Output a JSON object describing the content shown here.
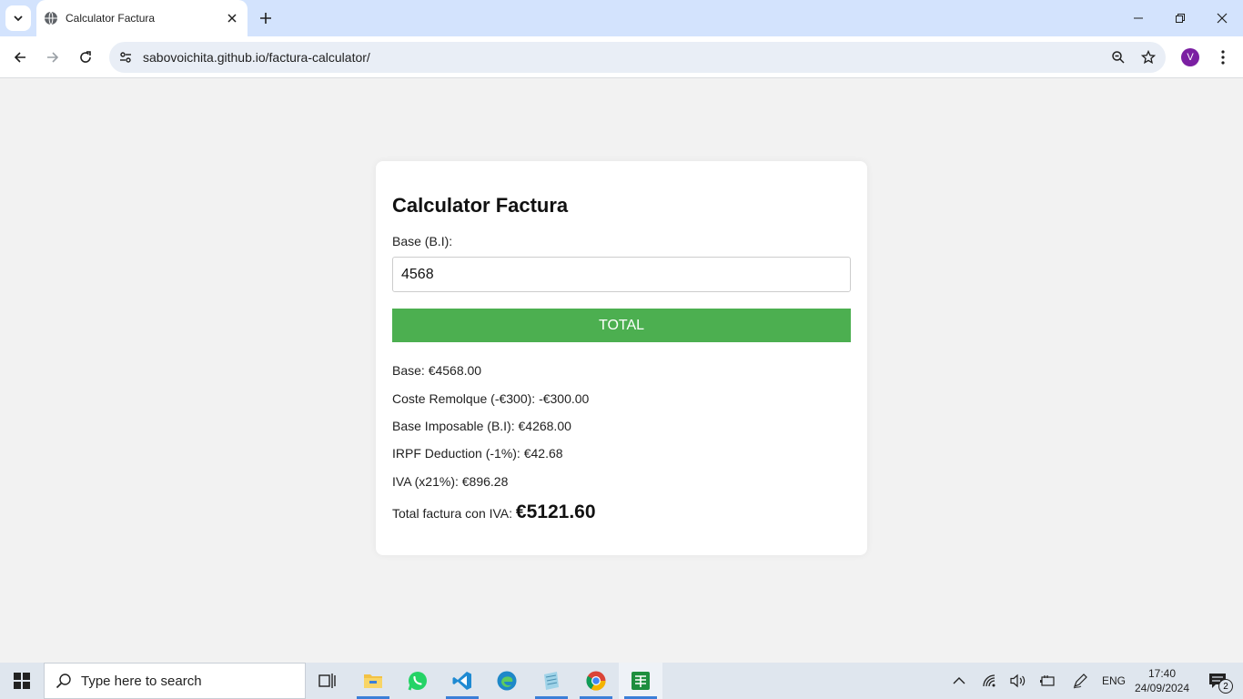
{
  "browser": {
    "tab_title": "Calculator Factura",
    "url": "sabovoichita.github.io/factura-calculator/",
    "profile_initial": "V"
  },
  "page": {
    "title": "Calculator Factura",
    "base_label": "Base (B.I):",
    "base_value": "4568",
    "total_button": "TOTAL",
    "results": {
      "base": "Base: €4568.00",
      "remolque": "Coste Remolque (-€300): -€300.00",
      "imposable": "Base Imposable (B.I): €4268.00",
      "irpf": "IRPF Deduction (-1%): €42.68",
      "iva": "IVA (x21%): €896.28",
      "total_label": "Total factura con IVA: ",
      "total_value": "€5121.60"
    }
  },
  "taskbar": {
    "search_placeholder": "Type here to search",
    "apps": [
      "task-view-icon",
      "file-explorer-icon",
      "whatsapp-icon",
      "vscode-icon",
      "edge-icon",
      "notepad-icon",
      "chrome-icon",
      "sheets-icon"
    ],
    "language": "ENG",
    "time": "17:40",
    "date": "24/09/2024",
    "notification_count": "2"
  },
  "colors": {
    "accent_green": "#4caf50",
    "tabbar_bg": "#d3e3fd",
    "page_bg": "#f2f2f2"
  }
}
